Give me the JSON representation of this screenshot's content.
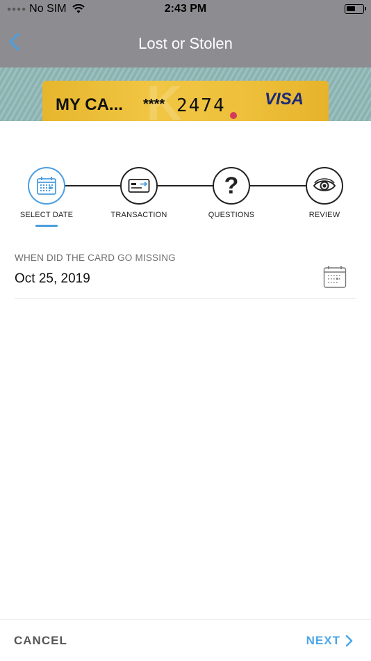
{
  "status_bar": {
    "carrier": "No SIM",
    "time": "2:43 PM"
  },
  "nav": {
    "title": "Lost or Stolen",
    "back_icon": "chevron-left-icon"
  },
  "card": {
    "name": "MY CA...",
    "masked": "****",
    "last_four": "2474",
    "network": "VISA",
    "color": "#f1c644"
  },
  "stepper": {
    "active_color": "#4a9ee0",
    "steps": [
      {
        "label": "SELECT DATE",
        "icon": "calendar-icon",
        "active": true
      },
      {
        "label": "TRANSACTION",
        "icon": "credit-card-icon",
        "active": false
      },
      {
        "label": "QUESTIONS",
        "icon": "question-icon",
        "active": false
      },
      {
        "label": "REVIEW",
        "icon": "eye-icon",
        "active": false
      }
    ]
  },
  "date_field": {
    "label": "WHEN DID THE CARD GO MISSING",
    "value": "Oct 25, 2019",
    "icon": "calendar-icon"
  },
  "footer": {
    "cancel_label": "CANCEL",
    "next_label": "NEXT",
    "next_color": "#4ba6e8"
  }
}
